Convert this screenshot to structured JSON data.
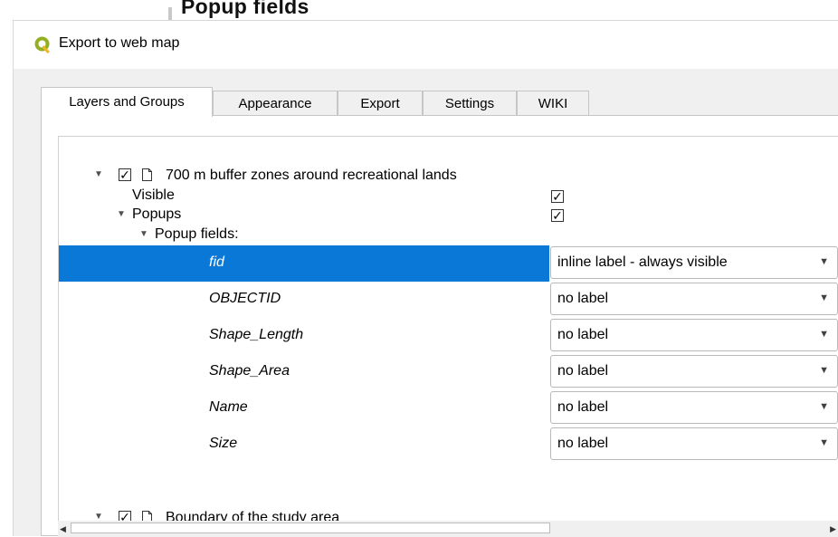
{
  "background_window": {
    "title": "Popup fields"
  },
  "dialog": {
    "title": "Export to web map"
  },
  "tabs": [
    {
      "label": "Layers and Groups",
      "active": true
    },
    {
      "label": "Appearance",
      "active": false
    },
    {
      "label": "Export",
      "active": false
    },
    {
      "label": "Settings",
      "active": false
    },
    {
      "label": "WIKI",
      "active": false
    }
  ],
  "tree": {
    "layer1": {
      "name": "700 m buffer zones around recreational lands",
      "checked": "✓",
      "visible_label": "Visible",
      "visible_check": "✓",
      "popups_label": "Popups",
      "popups_check": "✓",
      "popup_fields_label": "Popup fields:",
      "fields": [
        {
          "name": "fid",
          "label_option": "inline label - always visible",
          "selected": true
        },
        {
          "name": "OBJECTID",
          "label_option": "no label",
          "selected": false
        },
        {
          "name": "Shape_Length",
          "label_option": "no label",
          "selected": false
        },
        {
          "name": "Shape_Area",
          "label_option": "no label",
          "selected": false
        },
        {
          "name": "Name",
          "label_option": "no label",
          "selected": false
        },
        {
          "name": "Size",
          "label_option": "no label",
          "selected": false
        }
      ]
    },
    "layer2": {
      "name": "Boundary of the study area",
      "checked": "✓"
    }
  },
  "colors": {
    "selection": "#0a78d7",
    "dialog_bg": "#f0f0f0",
    "border": "#c6c6c6"
  },
  "icons": {
    "app": "qgis-logo-icon",
    "expand": "triangle-down-icon",
    "layer": "document-icon",
    "dropdown": "chevron-down-icon"
  }
}
